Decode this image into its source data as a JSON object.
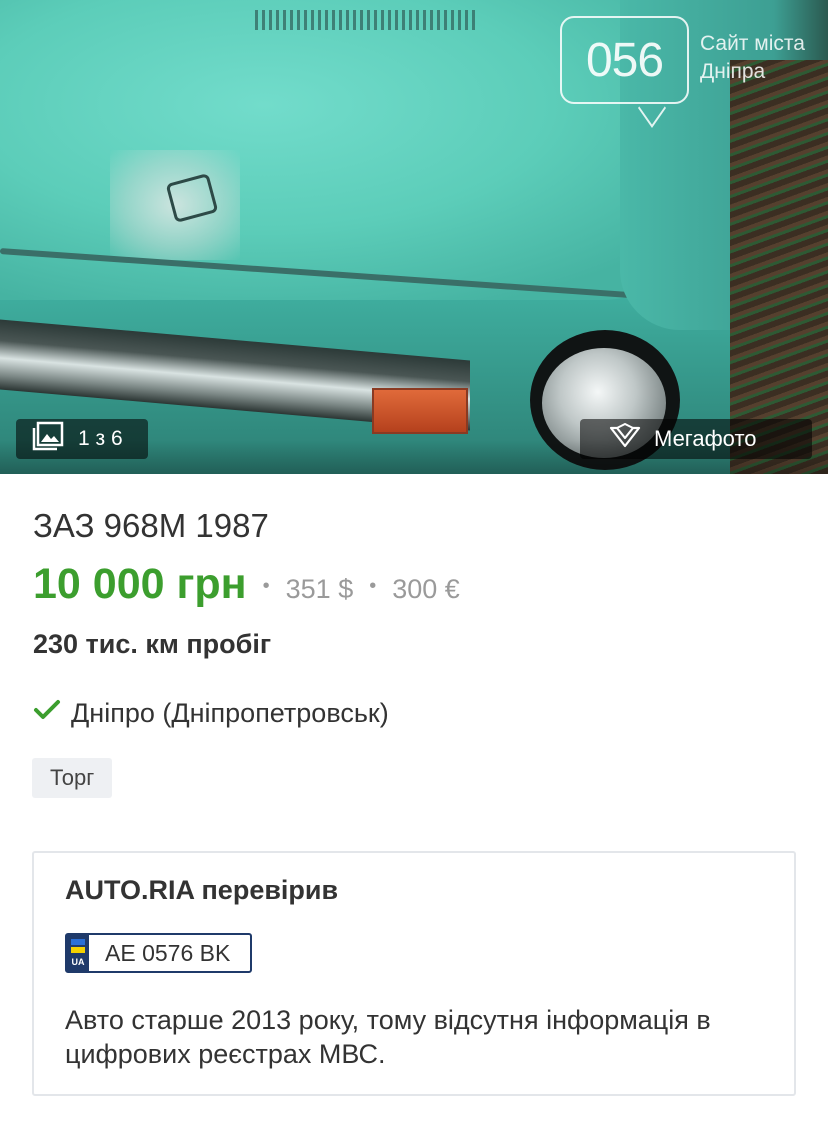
{
  "photo": {
    "counter": "1 з 6",
    "watermark_number": "056",
    "watermark_text": "Сайт міста Дніпра",
    "megafoto_label": "Мегафото"
  },
  "listing": {
    "title": "ЗАЗ 968М 1987",
    "price_main": "10 000 грн",
    "price_usd": "351 $",
    "price_eur": "300 €",
    "mileage": "230 тис. км пробіг",
    "location": "Дніпро (Дніпропетровськ)",
    "tag": "Торг"
  },
  "verification": {
    "title": "AUTO.RIA перевірив",
    "plate_country": "UA",
    "plate_number": "AE 0576 BK",
    "note": "Авто старше 2013 року, тому відсутня інформація в цифрових реєстрах МВС."
  },
  "colors": {
    "price_green": "#3c9e2e",
    "check_green": "#3c9e2e",
    "plate_blue": "#1f3a6a"
  }
}
